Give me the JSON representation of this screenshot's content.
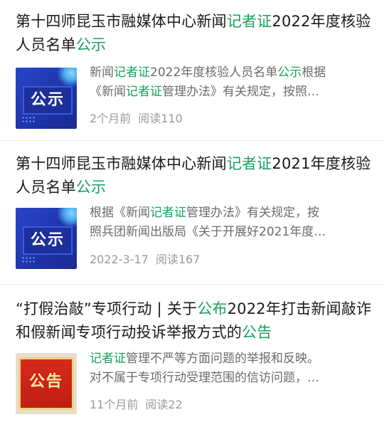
{
  "colors": {
    "highlight": "#1aa160",
    "meta": "#9a9a9a"
  },
  "articles": [
    {
      "title": [
        "第十四师昆玉市融媒体中心新闻",
        "记者证",
        "2022年度核验人员名单",
        "公示"
      ],
      "thumb_label": "公示",
      "summary_l1": [
        "新闻",
        "记者证",
        "2022年度核验人员名单",
        "公示",
        "根据"
      ],
      "summary_l2": [
        "《新闻",
        "记者证",
        "管理办法》有关规定，按照…"
      ],
      "time": "2个月前",
      "read": "阅读110"
    },
    {
      "title": [
        "第十四师昆玉市融媒体中心新闻",
        "记者证",
        "2021年度核验人员名单",
        "公示"
      ],
      "thumb_label": "公示",
      "summary_l1": [
        "根据《新闻",
        "记者证",
        "管理办法》有关规定，按"
      ],
      "summary_l2": [
        "照兵团新闻出版局《关于开展好2021年度…"
      ],
      "time": "2022-3-17",
      "read": "阅读167"
    },
    {
      "title": [
        "“打假治敲”专项行动 | 关于",
        "公布",
        "2022年打击新闻敲诈和假新闻专项行动投诉举报方式的",
        "公告"
      ],
      "thumb_label": "公告",
      "summary_l1": [
        "记者证",
        "管理不严等方面问题的举报和反映。"
      ],
      "summary_l2": [
        "对不属于专项行动受理范围的信访问题，…"
      ],
      "time": "11个月前",
      "read": "阅读22"
    }
  ]
}
